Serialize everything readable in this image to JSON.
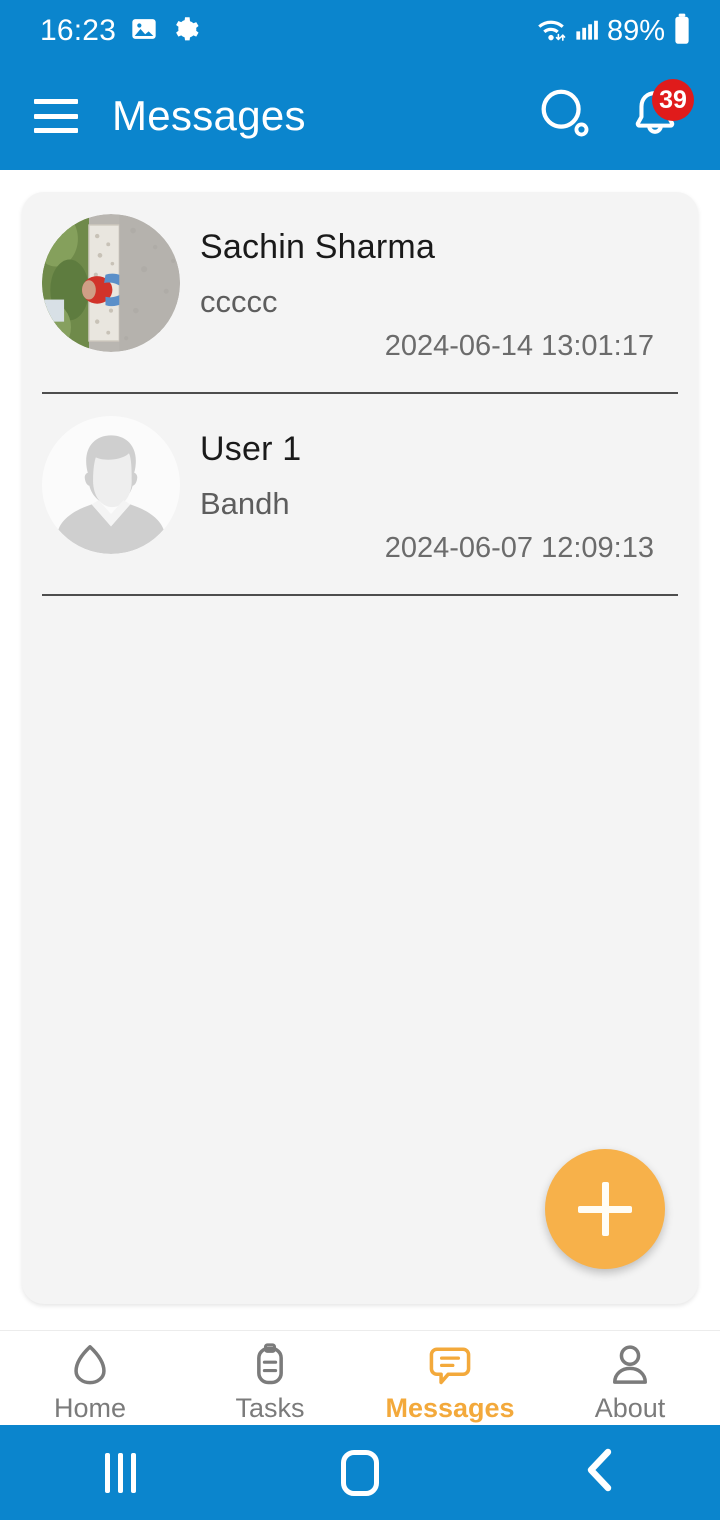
{
  "status_bar": {
    "time": "16:23",
    "battery_percent": "89%",
    "icons": [
      "image-icon",
      "gear-icon",
      "wifi-icon",
      "cellular-signal-icon",
      "battery-icon"
    ]
  },
  "app_bar": {
    "title": "Messages",
    "menu_icon": "hamburger-menu-icon",
    "search_icon": "search-icon",
    "notification_icon": "bell-icon",
    "notification_count": "39",
    "background_color": "#0b85cd",
    "badge_color": "#e01b1b"
  },
  "messages": [
    {
      "name": "Sachin Sharma",
      "preview": "ccccc",
      "timestamp": "2024-06-14 13:01:17",
      "avatar_type": "photo"
    },
    {
      "name": "User 1",
      "preview": "Bandh",
      "timestamp": "2024-06-07 12:09:13",
      "avatar_type": "placeholder"
    }
  ],
  "fab": {
    "label": "+",
    "icon": "plus-icon",
    "color": "#f7b14a"
  },
  "bottom_nav": {
    "active": "Messages",
    "accent_color": "#f3a93b",
    "inactive_color": "#7b7b7b",
    "items": [
      {
        "label": "Home",
        "icon": "home-icon",
        "active": false
      },
      {
        "label": "Tasks",
        "icon": "clipboard-icon",
        "active": false
      },
      {
        "label": "Messages",
        "icon": "chat-bubble-icon",
        "active": true
      },
      {
        "label": "About",
        "icon": "person-icon",
        "active": false
      }
    ]
  },
  "android_nav": {
    "recents_icon": "recents-icon",
    "home_icon": "home-square-icon",
    "back_icon": "back-chevron-icon"
  }
}
